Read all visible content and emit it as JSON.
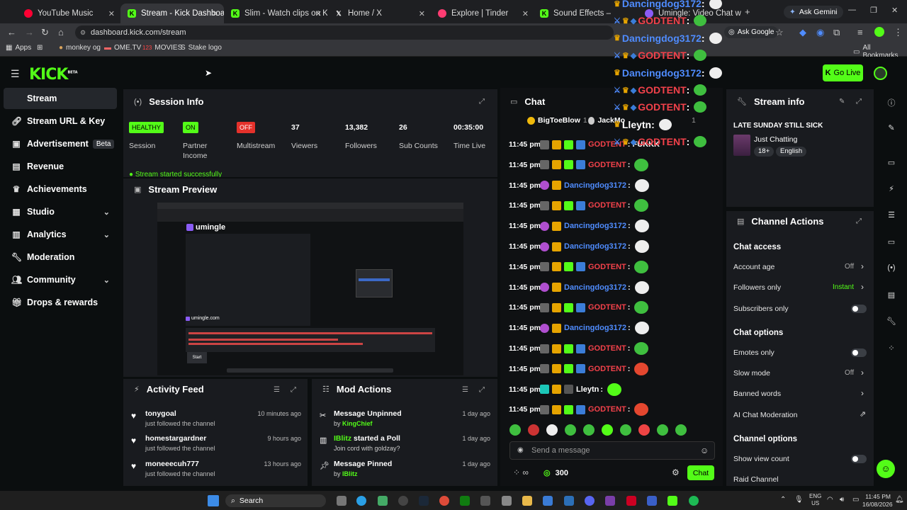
{
  "browser": {
    "tabs": [
      {
        "label": "YouTube Music",
        "color": "#ff0033"
      },
      {
        "label": "Stream - Kick Dashboard",
        "color": "#53fc18"
      },
      {
        "label": "Slim - Watch clips on Kick",
        "color": "#53fc18"
      },
      {
        "label": "Home / X",
        "color": "#ffffff"
      },
      {
        "label": "Explore | Tinder",
        "color": "#fe3c72"
      },
      {
        "label": "Sound Effects — Admin",
        "color": "#53fc18"
      },
      {
        "label": "Umingle: Video Chat w",
        "color": "#8a5cf6"
      }
    ],
    "ask_gemini": "Ask Gemini",
    "ask_google": "Ask Google",
    "url": "dashboard.kick.com/stream",
    "bookmarks": [
      "Apps",
      "monkey og",
      "OME.TV",
      "MOVIES",
      "Stake logo"
    ],
    "all_bookmarks": "All Bookmarks"
  },
  "app": {
    "logo": "KICK",
    "logo_badge": "BETA",
    "go_live": "Go Live",
    "accent": "#53fc18"
  },
  "sidebar": [
    {
      "label": "Stream",
      "icon": "broadcast-icon"
    },
    {
      "label": "Stream URL & Key",
      "icon": "link-icon"
    },
    {
      "label": "Advertisement",
      "badge": "Beta",
      "icon": "tv-icon"
    },
    {
      "label": "Revenue",
      "icon": "wallet-icon"
    },
    {
      "label": "Achievements",
      "icon": "trophy-icon"
    },
    {
      "label": "Studio",
      "icon": "studio-icon"
    },
    {
      "label": "Analytics",
      "icon": "chart-icon"
    },
    {
      "label": "Moderation",
      "icon": "wrench-icon"
    },
    {
      "label": "Community",
      "icon": "people-icon"
    },
    {
      "label": "Drops & rewards",
      "icon": "gift-icon"
    }
  ],
  "session": {
    "title": "Session Info",
    "stats": [
      {
        "value": "HEALTHY",
        "label": "Session",
        "pill": "#53fc18"
      },
      {
        "value": "ON",
        "label": "Partner Income",
        "pill": "#53fc18"
      },
      {
        "value": "OFF",
        "label": "Multistream",
        "pill": "#e5312b"
      },
      {
        "value": "37",
        "label": "Viewers"
      },
      {
        "value": "13,382",
        "label": "Followers"
      },
      {
        "value": "26",
        "label": "Sub Counts"
      },
      {
        "value": "00:35:00",
        "label": "Time Live"
      }
    ],
    "status": "Stream started successfully"
  },
  "preview": {
    "title": "Stream Preview",
    "site": "umingle",
    "site_footer": "umingle.com",
    "start": "Start"
  },
  "activity": {
    "title": "Activity Feed",
    "items": [
      {
        "name": "tonygoal",
        "sub": "just followed the channel",
        "time": "10 minutes ago"
      },
      {
        "name": "homestargardner",
        "sub": "just followed the channel",
        "time": "9 hours ago"
      },
      {
        "name": "moneeecuh777",
        "sub": "just followed the channel",
        "time": "13 hours ago"
      }
    ]
  },
  "mod_actions": {
    "title": "Mod Actions",
    "items": [
      {
        "title": "Message Unpinned",
        "by": "by",
        "user": "KingChief",
        "time": "1 day ago"
      },
      {
        "user": "IBlitz",
        "title": "started a Poll",
        "sub": "Join cord with goldzay?",
        "time": "1 day ago"
      },
      {
        "title": "Message Pinned",
        "by": "by",
        "user": "IBlitz",
        "time": "1 day ago"
      }
    ]
  },
  "chat": {
    "title": "Chat",
    "pinned": [
      {
        "name": "BigToeBlow",
        "count": "1"
      },
      {
        "name": "JackMo",
        "count": "1"
      }
    ],
    "messages": [
      {
        "time": "11:45 pm",
        "user": "GODTENT",
        "color": "#f2414a",
        "text": ": FUKKK"
      },
      {
        "time": "11:45 pm",
        "user": "GODTENT",
        "color": "#f2414a",
        "text": ":"
      },
      {
        "time": "11:45 pm",
        "user": "Dancingdog3172",
        "color": "#4f8cff",
        "text": ":"
      },
      {
        "time": "11:45 pm",
        "user": "GODTENT",
        "color": "#f2414a",
        "text": ":"
      },
      {
        "time": "11:45 pm",
        "user": "Dancingdog3172",
        "color": "#4f8cff",
        "text": ":"
      },
      {
        "time": "11:45 pm",
        "user": "Dancingdog3172",
        "color": "#4f8cff",
        "text": ":"
      },
      {
        "time": "11:45 pm",
        "user": "GODTENT",
        "color": "#f2414a",
        "text": ":"
      },
      {
        "time": "11:45 pm",
        "user": "Dancingdog3172",
        "color": "#4f8cff",
        "text": ":"
      },
      {
        "time": "11:45 pm",
        "user": "GODTENT",
        "color": "#f2414a",
        "text": ":"
      },
      {
        "time": "11:45 pm",
        "user": "Dancingdog3172",
        "color": "#4f8cff",
        "text": ":"
      },
      {
        "time": "11:45 pm",
        "user": "GODTENT",
        "color": "#f2414a",
        "text": ":"
      },
      {
        "time": "11:45 pm",
        "user": "GODTENT",
        "color": "#f2414a",
        "text": ":"
      },
      {
        "time": "11:45 pm",
        "user": "Lleytn",
        "color": "#ffffff",
        "text": ":"
      },
      {
        "time": "11:45 pm",
        "user": "GODTENT",
        "color": "#f2414a",
        "text": ":"
      }
    ],
    "input_placeholder": "Send a message",
    "points": "300",
    "send": "Chat"
  },
  "overlay": [
    {
      "user": "Dancingdog3172",
      "color": "#4f8cff"
    },
    {
      "user": "GODTENT",
      "color": "#f2414a"
    },
    {
      "user": "Dancingdog3172",
      "color": "#4f8cff"
    },
    {
      "user": "GODTENT",
      "color": "#f2414a"
    },
    {
      "user": "Dancingdog3172",
      "color": "#4f8cff"
    },
    {
      "user": "GODTENT",
      "color": "#f2414a"
    },
    {
      "user": "GODTENT",
      "color": "#f2414a"
    },
    {
      "user": "Lleytn",
      "color": "#ffffff"
    },
    {
      "user": "GODTENT",
      "color": "#f2414a"
    }
  ],
  "stream_info": {
    "title": "Stream info",
    "stream_title": "LATE SUNDAY STILL SICK",
    "category": "Just Chatting",
    "tags": [
      "18+",
      "English"
    ]
  },
  "channel_actions": {
    "title": "Channel Actions",
    "sections": [
      {
        "heading": "Chat access",
        "rows": [
          {
            "label": "Account age",
            "value": "Off",
            "kind": "chevron"
          },
          {
            "label": "Followers only",
            "value": "Instant",
            "kind": "chevron",
            "accent": true
          },
          {
            "label": "Subscribers only",
            "kind": "toggle"
          }
        ]
      },
      {
        "heading": "Chat options",
        "rows": [
          {
            "label": "Emotes only",
            "kind": "toggle"
          },
          {
            "label": "Slow mode",
            "value": "Off",
            "kind": "chevron"
          },
          {
            "label": "Banned words",
            "kind": "chevron"
          },
          {
            "label": "AI Chat Moderation",
            "kind": "external"
          }
        ]
      },
      {
        "heading": "Channel options",
        "rows": [
          {
            "label": "Show view count",
            "kind": "toggle"
          },
          {
            "label": "Raid Channel",
            "kind": "none"
          }
        ]
      }
    ]
  },
  "taskbar": {
    "search": "Search",
    "lang": "ENG",
    "region": "US",
    "time": "11:45 PM",
    "date": "16/08/2026"
  }
}
